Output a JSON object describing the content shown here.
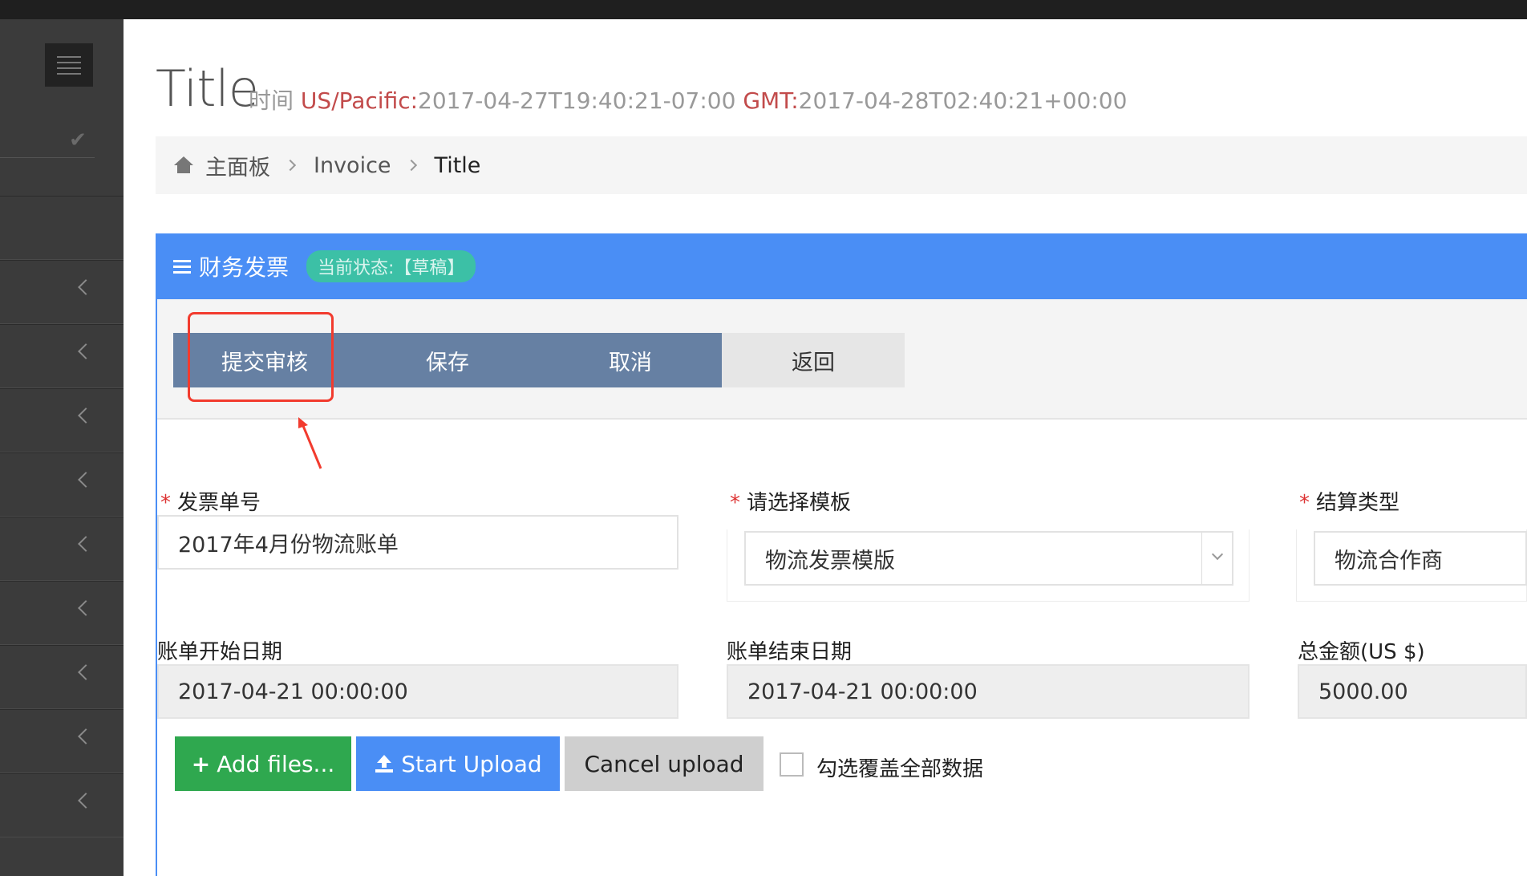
{
  "sidebar": {
    "items": [
      "",
      "",
      "",
      "",
      "",
      "",
      "",
      "",
      ""
    ]
  },
  "page": {
    "title": "Title",
    "time_label": "时间",
    "tz1_label": "US/Pacific:",
    "tz1_value": "2017-04-27T19:40:21-07:00",
    "tz2_label": "GMT:",
    "tz2_value": "2017-04-28T02:40:21+00:00"
  },
  "breadcrumb": {
    "home": "主面板",
    "parent": "Invoice",
    "current": "Title"
  },
  "panel": {
    "title": "财务发票",
    "status": "当前状态:【草稿】"
  },
  "toolbar": {
    "submit": "提交审核",
    "save": "保存",
    "cancel": "取消",
    "back": "返回"
  },
  "form": {
    "invoice_no_label": "发票单号",
    "invoice_no_value": "2017年4月份物流账单",
    "template_label": "请选择模板",
    "template_value": "物流发票模版",
    "settle_label": "结算类型",
    "settle_value": "物流合作商",
    "start_label": "账单开始日期",
    "start_value": "2017-04-21 00:00:00",
    "end_label": "账单结束日期",
    "end_value": "2017-04-21 00:00:00",
    "total_label": "总金额(US $)",
    "total_value": "5000.00",
    "required_mark": "*"
  },
  "upload": {
    "add": "Add files...",
    "start": "Start Upload",
    "cancel": "Cancel upload",
    "overwrite_label": "勾选覆盖全部数据",
    "overwrite_checked": false
  },
  "colors": {
    "accent": "#4a8ef5",
    "badge": "#3cc0a6",
    "toolbar_dark": "#6680a3",
    "highlight": "#f23b2e",
    "add_btn": "#2fa84f"
  }
}
